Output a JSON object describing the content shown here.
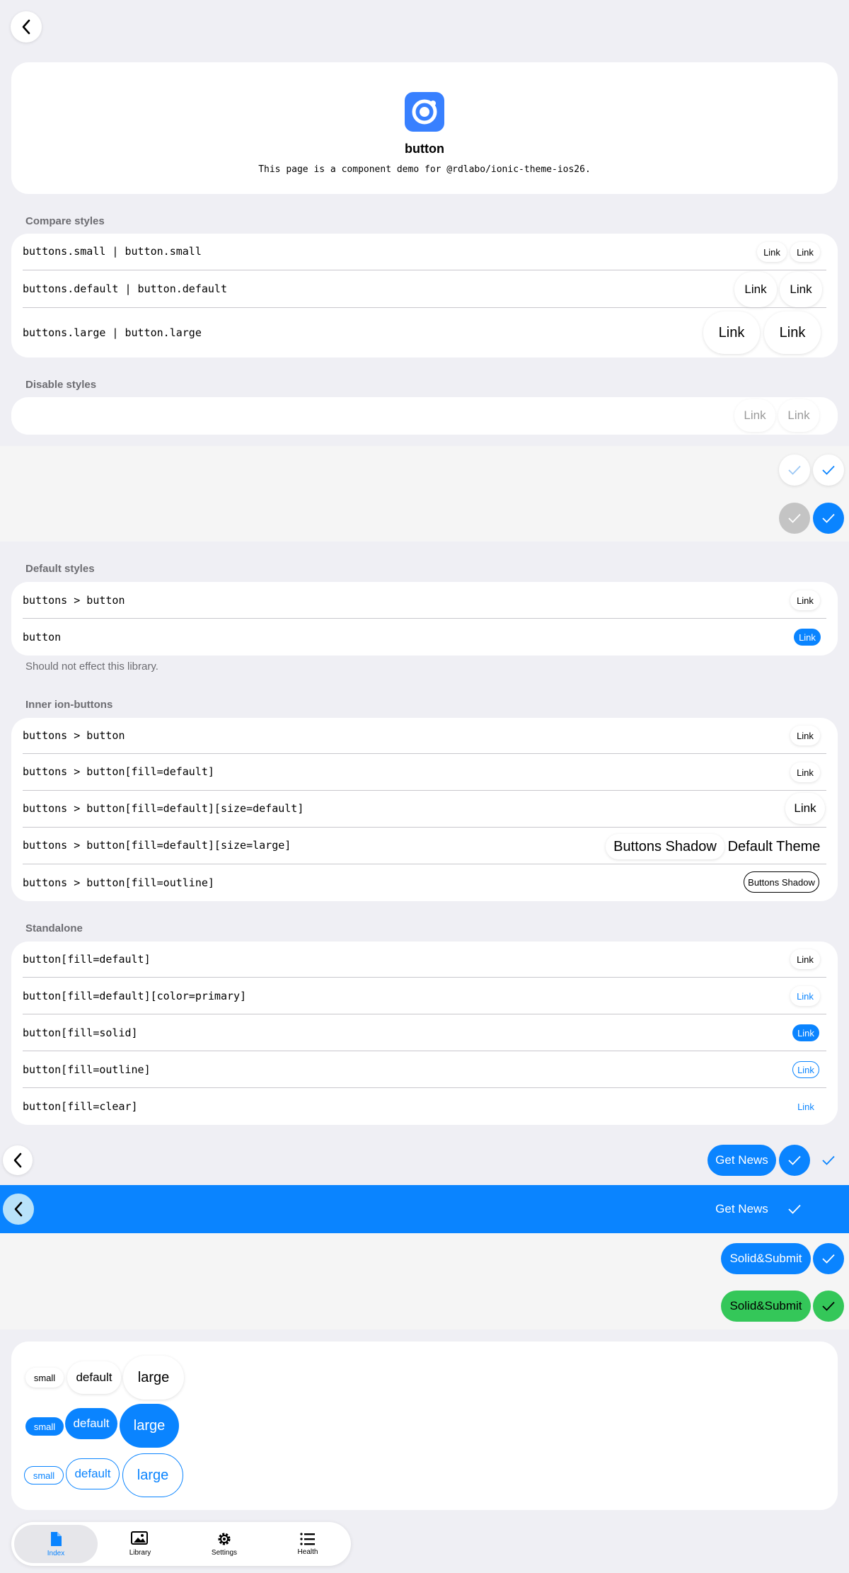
{
  "colors": {
    "accent": "#0a84ff",
    "success": "#34c759",
    "background": "#efeff4"
  },
  "header": {
    "back_icon": "chevron-left-icon",
    "app_icon": "ionic-logo-icon",
    "title": "button",
    "description": "This page is a component demo for @rdlabo/ionic-theme-ios26."
  },
  "compare": {
    "section_title": "Compare styles",
    "rows": [
      {
        "label": "buttons.small | button.small",
        "buttons": [
          "Link",
          "Link"
        ]
      },
      {
        "label": "buttons.default | button.default",
        "buttons": [
          "Link",
          "Link"
        ]
      },
      {
        "label": "buttons.large | button.large",
        "buttons": [
          "Link",
          "Link"
        ]
      }
    ]
  },
  "disable": {
    "section_title": "Disable styles",
    "buttons": [
      "Link",
      "Link"
    ]
  },
  "icon_band": {
    "icons": [
      "checkmark-icon",
      "checkmark-icon",
      "checkmark-icon",
      "checkmark-icon"
    ]
  },
  "default_styles": {
    "section_title": "Default styles",
    "rows": [
      {
        "label": "buttons > button",
        "button": "Link"
      },
      {
        "label": "button",
        "button": "Link"
      }
    ],
    "note": "Should not effect this library."
  },
  "inner": {
    "section_title": "Inner ion-buttons",
    "rows": [
      {
        "label": "buttons > button",
        "buttons": [
          "Link"
        ]
      },
      {
        "label": "buttons > button[fill=default]",
        "buttons": [
          "Link"
        ]
      },
      {
        "label": "buttons > button[fill=default][size=default]",
        "buttons": [
          "Link"
        ]
      },
      {
        "label": "buttons > button[fill=default][size=large]",
        "buttons": [
          "Buttons Shadow",
          "Default Theme"
        ]
      },
      {
        "label": "buttons > button[fill=outline]",
        "buttons": [
          "Buttons Shadow"
        ]
      }
    ]
  },
  "standalone": {
    "section_title": "Standalone",
    "rows": [
      {
        "label": "button[fill=default]",
        "button": "Link"
      },
      {
        "label": "button[fill=default][color=primary]",
        "button": "Link"
      },
      {
        "label": "button[fill=solid]",
        "button": "Link"
      },
      {
        "label": "button[fill=outline]",
        "button": "Link"
      },
      {
        "label": "button[fill=clear]",
        "button": "Link"
      }
    ]
  },
  "toolbars": {
    "toolbar1_button": "Get News",
    "toolbar2_button": "Get News",
    "solid_submit_1": "Solid&Submit",
    "solid_submit_2": "Solid&Submit"
  },
  "sizes": {
    "row1": [
      "small",
      "default",
      "large"
    ],
    "row2": [
      "small",
      "default",
      "large"
    ],
    "row3": [
      "small",
      "default",
      "large"
    ]
  },
  "tabbar": {
    "tabs": [
      {
        "label": "Index",
        "icon": "document-icon",
        "active": true
      },
      {
        "label": "Library",
        "icon": "images-icon",
        "active": false
      },
      {
        "label": "Settings",
        "icon": "gear-icon",
        "active": false
      },
      {
        "label": "Health",
        "icon": "list-icon",
        "active": false
      }
    ]
  }
}
